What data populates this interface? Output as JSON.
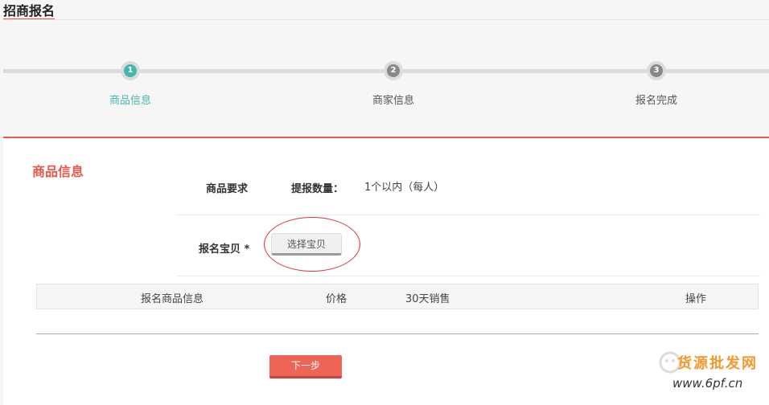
{
  "page": {
    "title": "招商报名"
  },
  "steps": [
    {
      "num": "1",
      "label": "商品信息",
      "active": true
    },
    {
      "num": "2",
      "label": "商家信息",
      "active": false
    },
    {
      "num": "3",
      "label": "报名完成",
      "active": false
    }
  ],
  "section": {
    "title": "商品信息",
    "requirement_label": "商品要求",
    "quantity_label": "提报数量：",
    "quantity_value": "1个以内（每人）",
    "entry_label": "报名宝贝 *",
    "choose_button": "选择宝贝"
  },
  "table": {
    "columns": [
      "报名商品信息",
      "价格",
      "30天销售",
      "操作"
    ]
  },
  "actions": {
    "next": "下一步"
  },
  "watermark": {
    "line1": "货源批发网",
    "line2": "www.6pf.cn"
  },
  "colors": {
    "accent": "#e8574a",
    "active_step": "#46b6b0"
  }
}
